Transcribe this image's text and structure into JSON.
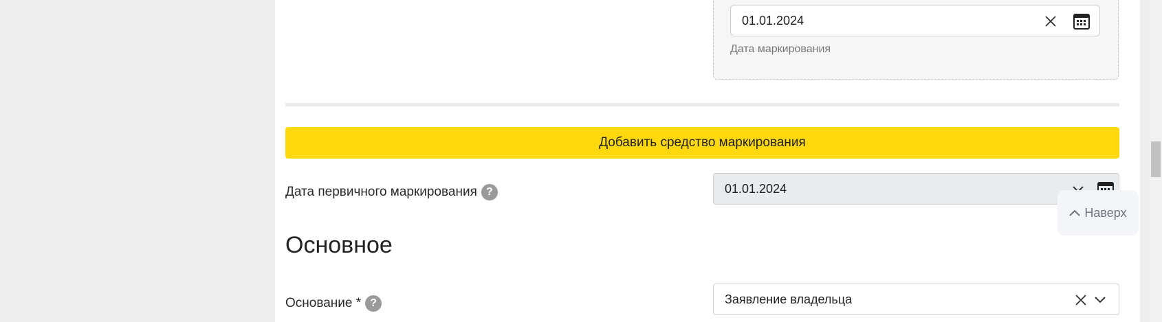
{
  "marking_date_group": {
    "date_value": "01.01.2024",
    "hint": "Дата маркирования",
    "clear_icon": "close-icon",
    "calendar_icon": "calendar-icon"
  },
  "add_marking_button": {
    "label": "Добавить средство маркирования"
  },
  "primary_marking_date": {
    "label": "Дата первичного маркирования",
    "help": "?",
    "value": "01.01.2024",
    "chevron_icon": "chevron-down-icon",
    "calendar_icon": "calendar-icon"
  },
  "section": {
    "title": "Основное"
  },
  "basis": {
    "label": "Основание *",
    "help": "?",
    "value": "Заявление владельца",
    "clear_icon": "close-icon",
    "chevron_icon": "chevron-down-icon"
  },
  "back_to_top": {
    "label": "Наверх",
    "icon": "chevron-up-icon"
  },
  "colors": {
    "accent_yellow": "#ffd80d",
    "help_badge": "#9a9a9a"
  }
}
